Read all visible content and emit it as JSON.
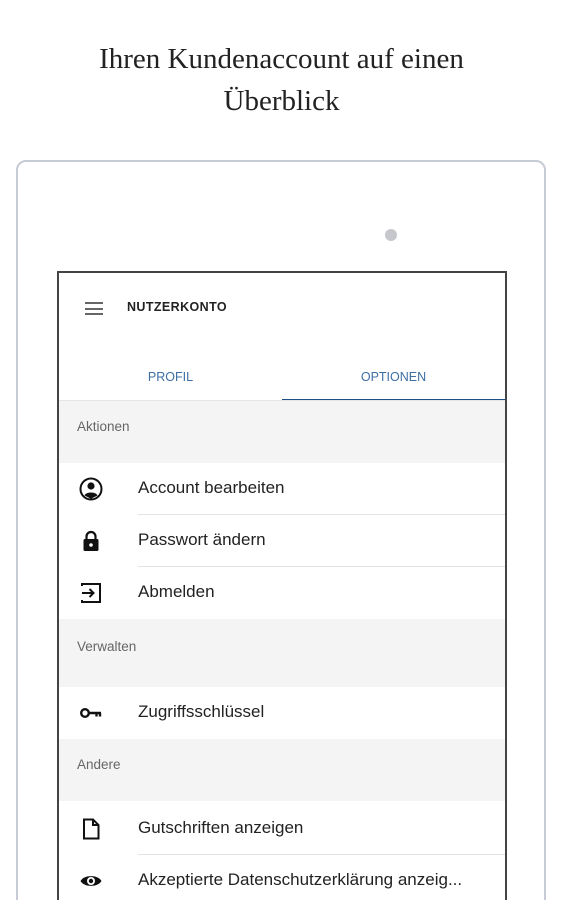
{
  "headline": {
    "line1": "Ihren Kundenaccount auf einen",
    "line2": "Überblick"
  },
  "appbar": {
    "title": "NUTZERKONTO",
    "menu_icon": "hamburger-menu-icon"
  },
  "tabs": [
    {
      "label": "PROFIL",
      "active": false
    },
    {
      "label": "OPTIONEN",
      "active": true
    }
  ],
  "sections": {
    "aktionen": {
      "header": "Aktionen",
      "items": [
        {
          "label": "Account bearbeiten",
          "icon": "account-circle-icon"
        },
        {
          "label": "Passwort ändern",
          "icon": "lock-icon"
        },
        {
          "label": "Abmelden",
          "icon": "logout-icon"
        }
      ]
    },
    "verwalten": {
      "header": "Verwalten",
      "items": [
        {
          "label": "Zugriffsschlüssel",
          "icon": "key-icon"
        }
      ]
    },
    "andere": {
      "header": "Andere",
      "items": [
        {
          "label": "Gutschriften anzeigen",
          "icon": "document-icon"
        },
        {
          "label": "Akzeptierte Datenschutzerklärung anzeig...",
          "icon": "eye-icon"
        }
      ]
    }
  },
  "colors": {
    "accent": "#1f4e85",
    "tab_text": "#3d6fa3",
    "section_bg": "#f4f4f4"
  }
}
